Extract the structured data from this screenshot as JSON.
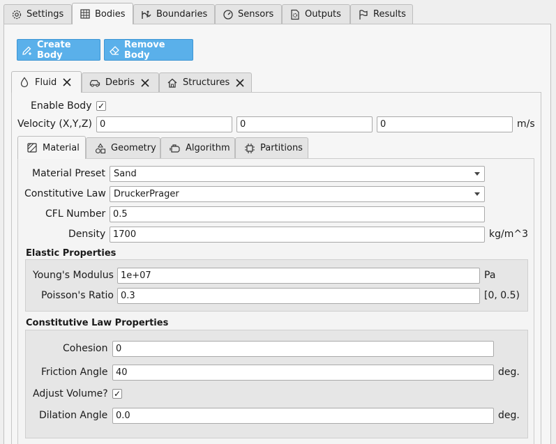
{
  "top_tabs": [
    {
      "label": "Settings",
      "icon": "gear-icon"
    },
    {
      "label": "Bodies",
      "icon": "grid-cube-icon"
    },
    {
      "label": "Boundaries",
      "icon": "wave-figure-icon"
    },
    {
      "label": "Sensors",
      "icon": "gauge-icon"
    },
    {
      "label": "Outputs",
      "icon": "file-gear-icon"
    },
    {
      "label": "Results",
      "icon": "flag-icon"
    }
  ],
  "active_top_tab": "Bodies",
  "actions": {
    "create_body": "Create Body",
    "remove_body": "Remove Body"
  },
  "body_tabs": [
    {
      "label": "Fluid",
      "icon": "droplet-icon"
    },
    {
      "label": "Debris",
      "icon": "car-icon"
    },
    {
      "label": "Structures",
      "icon": "house-icon"
    }
  ],
  "body": {
    "enable_label": "Enable Body",
    "enabled": true,
    "velocity_label": "Velocity (X,Y,Z)",
    "velocity": [
      "0",
      "0",
      "0"
    ],
    "velocity_unit": "m/s"
  },
  "sub_tabs": [
    {
      "label": "Material",
      "icon": "material-icon"
    },
    {
      "label": "Geometry",
      "icon": "shapes-icon"
    },
    {
      "label": "Algorithm",
      "icon": "engine-icon"
    },
    {
      "label": "Partitions",
      "icon": "chip-icon"
    }
  ],
  "material": {
    "preset_label": "Material Preset",
    "preset_value": "Sand",
    "law_label": "Constitutive Law",
    "law_value": "DruckerPrager",
    "cfl_label": "CFL Number",
    "cfl_value": "0.5",
    "density_label": "Density",
    "density_value": "1700",
    "density_unit": "kg/m^3"
  },
  "elastic": {
    "title": "Elastic Properties",
    "youngs_label": "Young's Modulus",
    "youngs_value": "1e+07",
    "youngs_unit": "Pa",
    "poisson_label": "Poisson's Ratio",
    "poisson_value": "0.3",
    "poisson_range": "[0, 0.5)"
  },
  "law_props": {
    "title": "Constitutive Law Properties",
    "cohesion_label": "Cohesion",
    "cohesion_value": "0",
    "friction_label": "Friction Angle",
    "friction_value": "40",
    "friction_unit": "deg.",
    "adjust_label": "Adjust Volume?",
    "adjust_checked": true,
    "dilation_label": "Dilation Angle",
    "dilation_value": "0.0",
    "dilation_unit": "deg."
  },
  "colors": {
    "accent_button": "#5ab0ea",
    "panel": "#f6f6f6",
    "group": "#e6e6e6"
  }
}
